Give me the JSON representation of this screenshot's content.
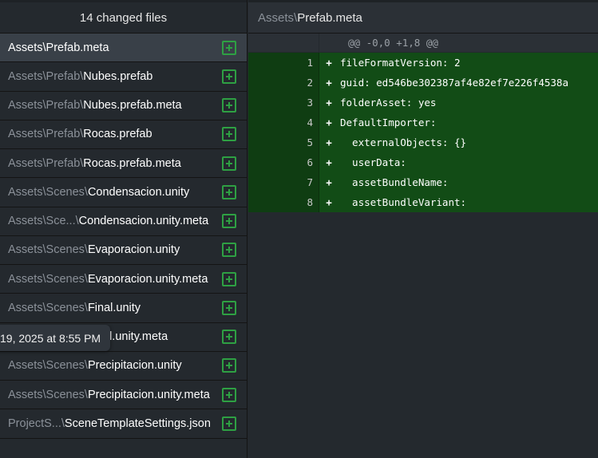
{
  "files_panel": {
    "header": "14 changed files",
    "files": [
      {
        "dir": "",
        "name": "Assets\\Prefab.meta",
        "selected": true
      },
      {
        "dir": "Assets\\Prefab\\",
        "name": "Nubes.prefab"
      },
      {
        "dir": "Assets\\Prefab\\",
        "name": "Nubes.prefab.meta"
      },
      {
        "dir": "Assets\\Prefab\\",
        "name": "Rocas.prefab"
      },
      {
        "dir": "Assets\\Prefab\\",
        "name": "Rocas.prefab.meta"
      },
      {
        "dir": "Assets\\Scenes\\",
        "name": "Condensacion.unity"
      },
      {
        "dir": "Assets\\Sce...\\",
        "name": "Condensacion.unity.meta"
      },
      {
        "dir": "Assets\\Scenes\\",
        "name": "Evaporacion.unity"
      },
      {
        "dir": "Assets\\Scenes\\",
        "name": "Evaporacion.unity.meta"
      },
      {
        "dir": "Assets\\Scenes\\",
        "name": "Final.unity"
      },
      {
        "dir": "Assets\\Scenes\\",
        "name": "Final.unity.meta"
      },
      {
        "dir": "Assets\\Scenes\\",
        "name": "Precipitacion.unity"
      },
      {
        "dir": "Assets\\Scenes\\",
        "name": "Precipitacion.unity.meta"
      },
      {
        "dir": "ProjectS...\\",
        "name": "SceneTemplateSettings.json"
      }
    ],
    "partial_name_under_tooltip": "al.unity.meta"
  },
  "tooltip": "19, 2025 at 8:55 PM",
  "diff": {
    "header_dir": "Assets\\",
    "header_name": "Prefab.meta",
    "hunk": "@@ -0,0 +1,8 @@",
    "lines": [
      {
        "num": "1",
        "sign": "+",
        "code": "fileFormatVersion: 2"
      },
      {
        "num": "2",
        "sign": "+",
        "code": "guid: ed546be302387af4e82ef7e226f4538a"
      },
      {
        "num": "3",
        "sign": "+",
        "code": "folderAsset: yes"
      },
      {
        "num": "4",
        "sign": "+",
        "code": "DefaultImporter:"
      },
      {
        "num": "5",
        "sign": "+",
        "code": "  externalObjects: {}"
      },
      {
        "num": "6",
        "sign": "+",
        "code": "  userData:"
      },
      {
        "num": "7",
        "sign": "+",
        "code": "  assetBundleName:"
      },
      {
        "num": "8",
        "sign": "+",
        "code": "  assetBundleVariant:"
      }
    ]
  },
  "colors": {
    "added_line_bg": "#124c16",
    "added_icon": "#2ea043",
    "selected_row_bg": "#394048"
  },
  "icons": {
    "added_file": "plus-square-icon"
  }
}
